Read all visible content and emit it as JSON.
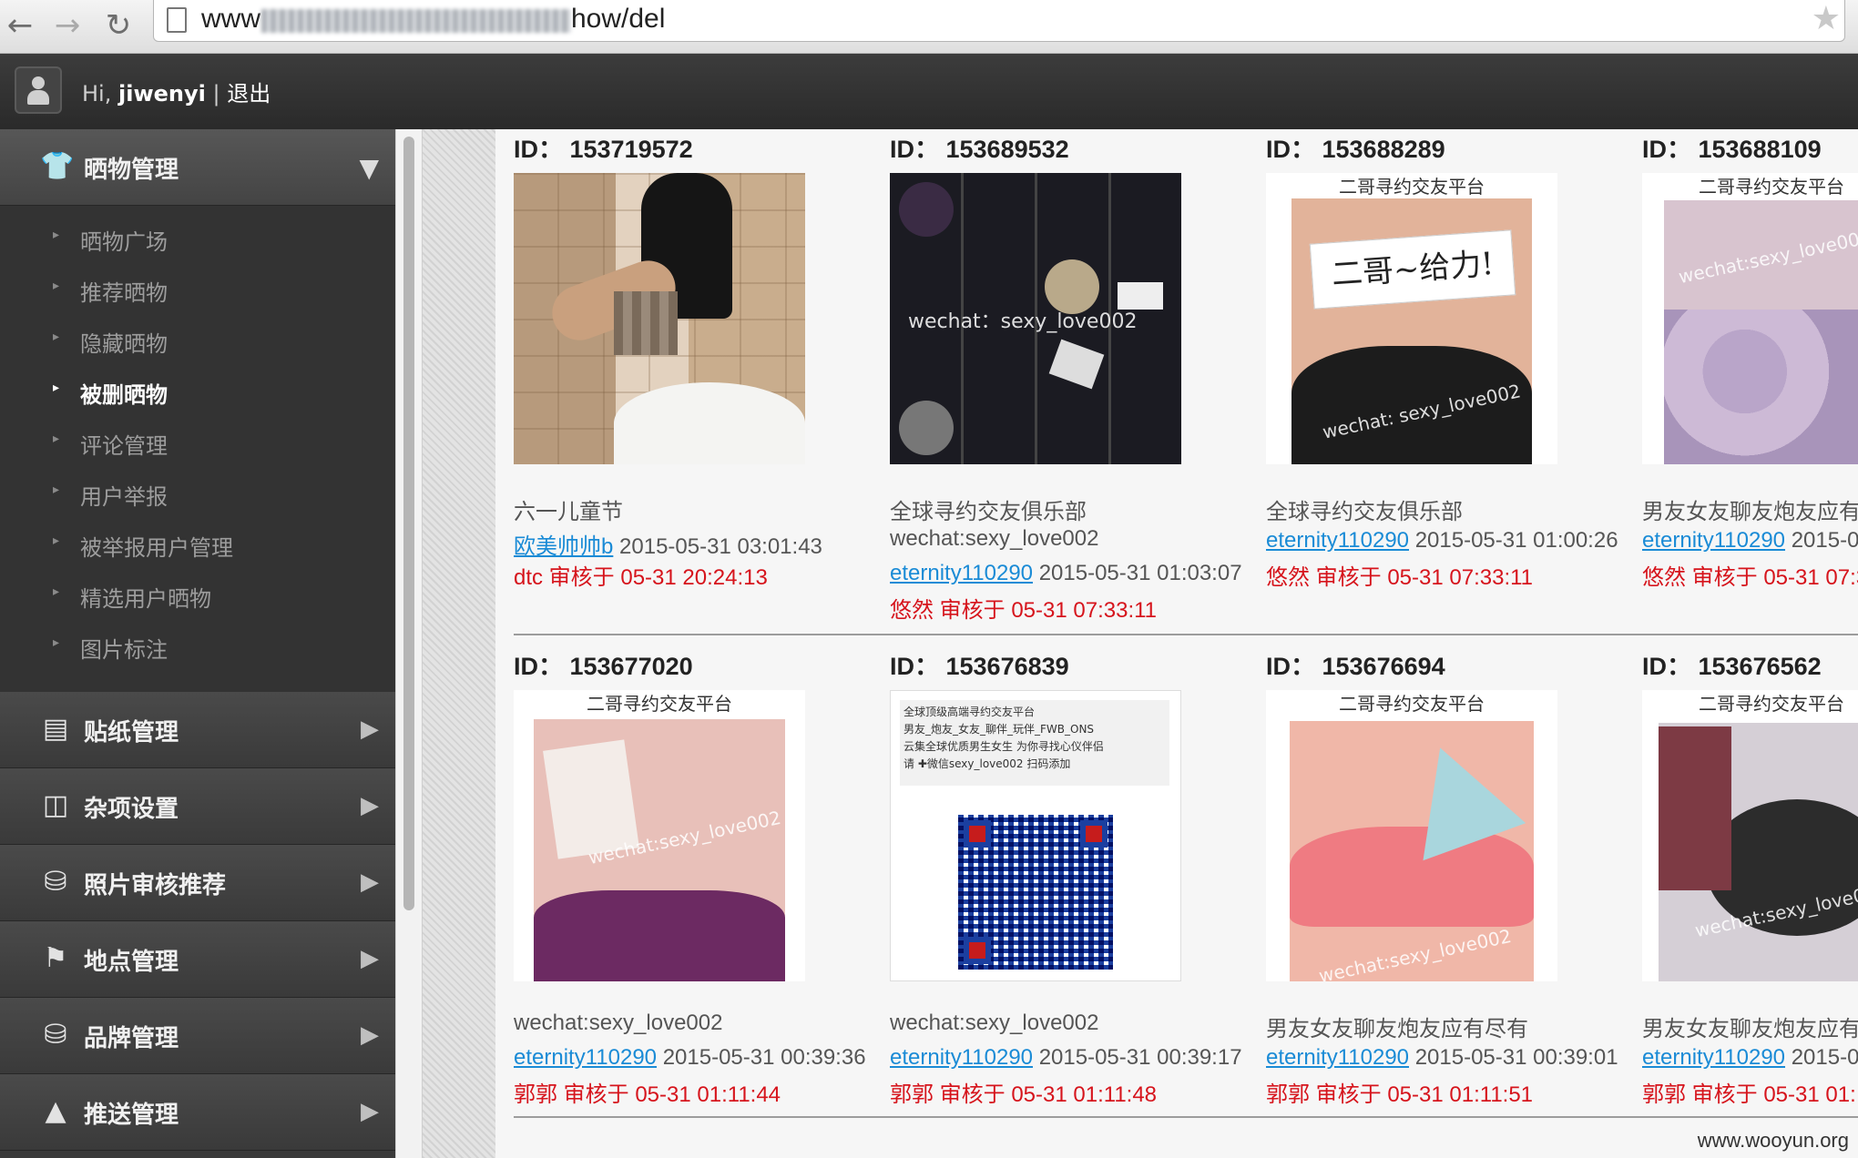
{
  "browser": {
    "url_suffix": "how/del",
    "url_prefix": "www"
  },
  "header": {
    "greeting": "Hi,",
    "username": "jiwenyi",
    "separator": "|",
    "logout": "退出"
  },
  "sidebar": {
    "open_menu": {
      "label": "晒物管理",
      "icon": "shirt-icon"
    },
    "sub_items": [
      {
        "label": "晒物广场",
        "active": false
      },
      {
        "label": "推荐晒物",
        "active": false
      },
      {
        "label": "隐藏晒物",
        "active": false
      },
      {
        "label": "被删晒物",
        "active": true
      },
      {
        "label": "评论管理",
        "active": false
      },
      {
        "label": "用户举报",
        "active": false
      },
      {
        "label": "被举报用户管理",
        "active": false
      },
      {
        "label": "精选用户晒物",
        "active": false
      },
      {
        "label": "图片标注",
        "active": false
      }
    ],
    "menus": [
      {
        "label": "贴纸管理",
        "icon": "sticker-icon"
      },
      {
        "label": "杂项设置",
        "icon": "basket-icon"
      },
      {
        "label": "照片审核推荐",
        "icon": "trophy-icon"
      },
      {
        "label": "地点管理",
        "icon": "flag-icon"
      },
      {
        "label": "品牌管理",
        "icon": "trophy-icon"
      },
      {
        "label": "推送管理",
        "icon": "upload-icon"
      }
    ]
  },
  "cards": [
    {
      "id": "ID：  153719572",
      "title": "六一儿童节",
      "title2": "",
      "user": "欧美帅帅b",
      "time": "2015-05-31 03:01:43",
      "review": "dtc 审核于 05-31 20:24:13"
    },
    {
      "id": "ID：  153689532",
      "title": "全球寻约交友俱乐部",
      "title2": "wechat:sexy_love002",
      "user": "eternity110290",
      "time": "2015-05-31 01:03:07",
      "review": "悠然 审核于 05-31 07:33:11"
    },
    {
      "id": "ID：  153688289",
      "title": "全球寻约交友俱乐部",
      "title2": "",
      "user": "eternity110290",
      "time": "2015-05-31 01:00:26",
      "review": "悠然 审核于 05-31 07:33:11"
    },
    {
      "id": "ID：  153688109",
      "title": "男友女友聊友炮友应有",
      "title2": "",
      "user": "eternity110290",
      "time": "2015-0",
      "review": "悠然 审核于 05-31 07:3"
    },
    {
      "id": "ID：  153677020",
      "title": "wechat:sexy_love002",
      "title2": "",
      "user": "eternity110290",
      "time": "2015-05-31 00:39:36",
      "review": "郭郭 审核于 05-31 01:11:44"
    },
    {
      "id": "ID：  153676839",
      "title": "wechat:sexy_love002",
      "title2": "",
      "user": "eternity110290",
      "time": "2015-05-31 00:39:17",
      "review": "郭郭 审核于 05-31 01:11:48"
    },
    {
      "id": "ID：  153676694",
      "title": "男友女友聊友炮友应有尽有",
      "title2": "",
      "user": "eternity110290",
      "time": "2015-05-31 00:39:01",
      "review": "郭郭 审核于 05-31 01:11:51"
    },
    {
      "id": "ID：  153676562",
      "title": "男友女友聊友炮友应有",
      "title2": "",
      "user": "eternity110290",
      "time": "2015-0",
      "review": "郭郭 审核于 05-31 01:"
    }
  ],
  "thumb_text": {
    "platform_banner": "二哥寻约交友平台",
    "watermark_wechat": "wechat:sexy_love002",
    "watermark_car": "wechat：sexy_love002",
    "watermark_bra": "wechat: sexy_love002",
    "sign_text": "二哥~给力!",
    "qr_lines": [
      "全球顶级高端寻约交友平台",
      "男友_炮友_女友_聊伴_玩伴_FWB_ONS",
      "云集全球优质男生女生 为你寻找心仪伴侣",
      "请 ✚微信sexy_love002  扫码添加"
    ]
  },
  "watermark": "www.wooyun.org"
}
